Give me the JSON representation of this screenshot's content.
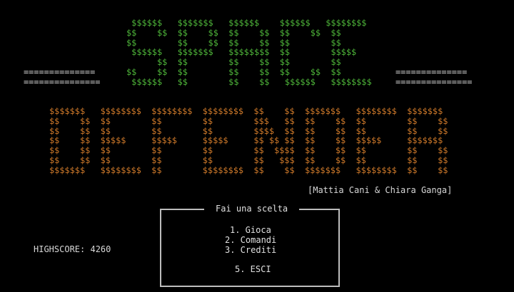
{
  "title_art": {
    "space": [
      " $$$$$$   $$$$$$$   $$$$$$    $$$$$$   $$$$$$$$",
      "$$    $$  $$    $$  $$    $$  $$    $$  $$",
      "$$        $$    $$  $$    $$  $$        $$",
      " $$$$$$   $$$$$$$   $$$$$$$$  $$        $$$$$",
      "      $$  $$        $$    $$  $$        $$",
      "$$    $$  $$        $$    $$  $$    $$  $$",
      " $$$$$$   $$        $$    $$   $$$$$$   $$$$$$$$"
    ],
    "decor_left": [
      "==============",
      "==============="
    ],
    "decor_right": [
      "==============",
      "==============="
    ],
    "defender": [
      "$$$$$$$   $$$$$$$$  $$$$$$$$  $$$$$$$$  $$    $$  $$$$$$$   $$$$$$$$  $$$$$$$",
      "$$    $$  $$        $$        $$        $$$   $$  $$    $$  $$        $$    $$",
      "$$    $$  $$        $$        $$        $$$$  $$  $$    $$  $$        $$    $$",
      "$$    $$  $$$$$     $$$$$     $$$$$     $$ $$ $$  $$    $$  $$$$$     $$$$$$$",
      "$$    $$  $$        $$        $$        $$  $$$$  $$    $$  $$        $$    $$",
      "$$    $$  $$        $$        $$        $$   $$$  $$    $$  $$        $$    $$",
      "$$$$$$$   $$$$$$$$  $$        $$$$$$$$  $$    $$  $$$$$$$   $$$$$$$$  $$    $$"
    ]
  },
  "authors": "[Mattia Cani & Chiara Ganga]",
  "highscore": {
    "label": "HIGHSCORE:",
    "value": "4260"
  },
  "menu": {
    "title": "Fai una scelta",
    "items": [
      "1. Gioca",
      "2. Comandi",
      "3. Crediti",
      "5. ESCI"
    ]
  },
  "colors": {
    "background": "#000000",
    "space_art": "#4fb83a",
    "defender_art": "#d07a2a",
    "text": "#d8d8d8",
    "border": "#bdbdbd"
  }
}
